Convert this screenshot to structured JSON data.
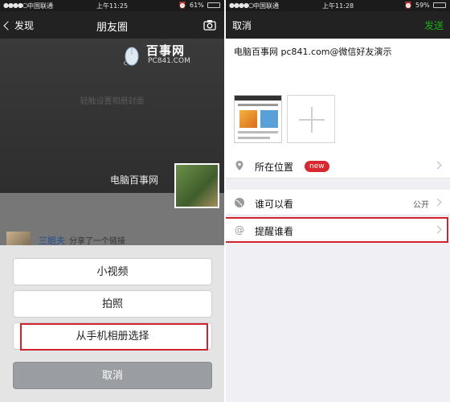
{
  "left": {
    "status": {
      "carrier": "中国联通",
      "time": "上午11:25",
      "battery": "61%"
    },
    "nav": {
      "back_label": "发现",
      "title": "朋友圈"
    },
    "cover": {
      "watermark_big": "百事网",
      "watermark_small": "PC841.COM",
      "hint": "轻触设置相册封面",
      "user_name": "电脑百事网"
    },
    "feed": {
      "author": "三姐夫",
      "action": "分享了一个链接"
    },
    "sheet": {
      "video_label": "小视频",
      "photo_label": "拍照",
      "album_label": "从手机相册选择",
      "cancel_label": "取消"
    }
  },
  "right": {
    "status": {
      "carrier": "中国联通",
      "time": "上午11:28",
      "battery": "59%"
    },
    "nav": {
      "cancel_label": "取消",
      "send_label": "发送"
    },
    "post_text": "电脑百事网 pc841.com@微信好友演示",
    "location": {
      "label": "所在位置",
      "badge": "new"
    },
    "visibility": {
      "label": "谁可以看",
      "value": "公开"
    },
    "remind": {
      "label": "提醒谁看"
    }
  },
  "colors": {
    "send_green": "#1aad19",
    "highlight_red": "#d2222d",
    "badge_red": "#d8282f",
    "link_blue": "#3a5a8a"
  }
}
